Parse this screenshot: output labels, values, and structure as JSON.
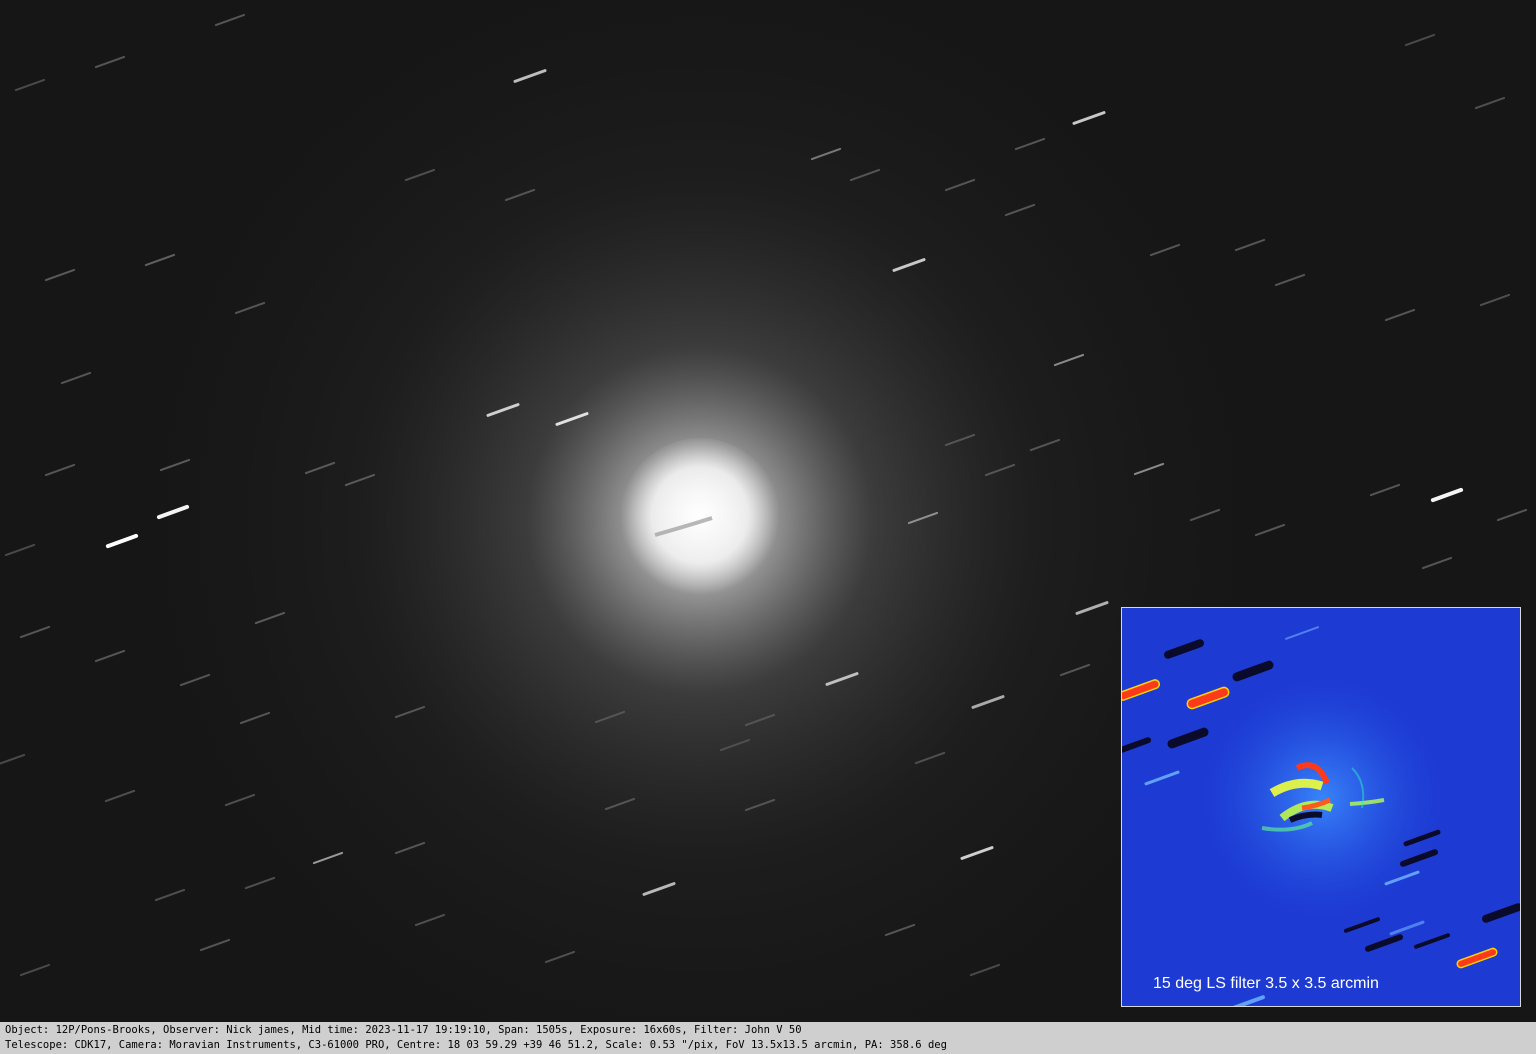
{
  "photo": {
    "subject": "comet",
    "inset_caption": "15 deg LS filter 3.5 x 3.5 arcmin"
  },
  "info": {
    "line1": "Object: 12P/Pons-Brooks, Observer: Nick james, Mid time: 2023-11-17 19:19:10, Span: 1505s, Exposure: 16x60s, Filter: John V 50",
    "line2": "Telescope: CDK17, Camera: Moravian Instruments, C3-61000 PRO, Centre: 18 03 59.29 +39 46 51.2, Scale: 0.53 \"/pix, FoV 13.5x13.5 arcmin, PA: 358.6 deg"
  },
  "colors": {
    "sky": "#161616",
    "inset_background": "#1e3fd6",
    "info_bar": "#cfcfcf"
  }
}
